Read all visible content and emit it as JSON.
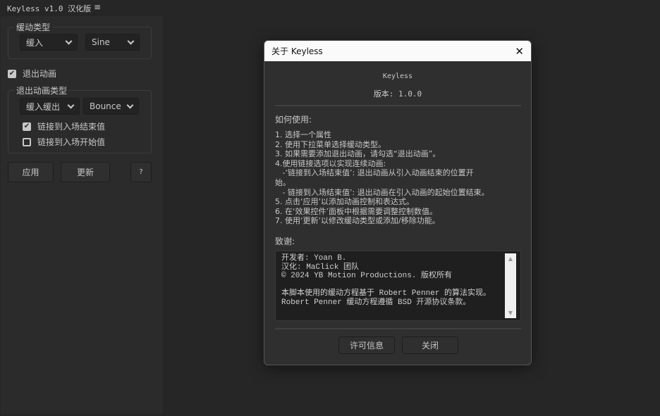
{
  "app": {
    "title": "Keyless v1.0 汉化版",
    "menu_icon": "≡"
  },
  "ease_group": {
    "label": "缓动类型",
    "direction": "缓入",
    "curve": "Sine"
  },
  "exit": {
    "label": "退出动画",
    "checked": true
  },
  "exit_group": {
    "label": "退出动画类型",
    "direction": "缓入缓出",
    "curve": "Bounce",
    "link_end": {
      "label": "链接到入场结束值",
      "checked": true
    },
    "link_start": {
      "label": "链接到入场开始值",
      "checked": false
    }
  },
  "buttons": {
    "apply": "应用",
    "update": "更新",
    "help": "?"
  },
  "dialog": {
    "title": "关于 Keyless",
    "close": "✕",
    "name": "Keyless",
    "version": "版本: 1.0.0",
    "how_title": "如何使用:",
    "how": [
      "1. 选择一个属性",
      "2. 使用下拉菜单选择缓动类型。",
      "3. 如果需要添加退出动画，请勾选“退出动画”。",
      "4.使用链接选项以实现连续动画:",
      "   -‘链接到入场结束值’: 退出动画从引入动画结束的位置开",
      "始。",
      "   - 链接到入场结束值’: 退出动画在引入动画的起始位置结束。",
      "5. 点击‘应用’以添加动画控制和表达式。",
      "6. 在‘效果控件’面板中根据需要调整控制数值。",
      "7. 使用‘更新’以修改缓动类型或添加/移除功能。"
    ],
    "credits_title": "致谢:",
    "credits": [
      "开发者: Yoan B.",
      "汉化: MaClick 团队",
      "© 2024 YB Motion Productions. 版权所有",
      "",
      "本脚本使用的缓动方程基于 Robert Penner 的算法实现。",
      "Robert Penner 缓动方程遵循 BSD 开源协议条款。"
    ],
    "license_btn": "许可信息",
    "close_btn": "关闭"
  }
}
